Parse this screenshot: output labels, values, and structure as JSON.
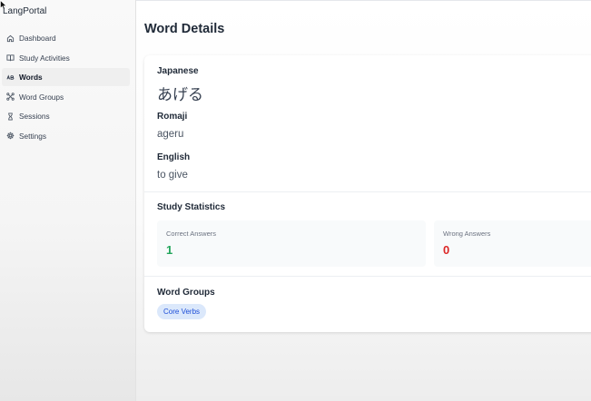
{
  "app": {
    "title": "LangPortal"
  },
  "sidebar": {
    "items": [
      {
        "label": "Dashboard",
        "icon": "home-icon",
        "active": false
      },
      {
        "label": "Study Activities",
        "icon": "book-icon",
        "active": false
      },
      {
        "label": "Words",
        "icon": "words-icon",
        "active": true
      },
      {
        "label": "Word Groups",
        "icon": "groups-icon",
        "active": false
      },
      {
        "label": "Sessions",
        "icon": "hourglass-icon",
        "active": false
      },
      {
        "label": "Settings",
        "icon": "gear-icon",
        "active": false
      }
    ]
  },
  "page": {
    "title": "Word Details"
  },
  "word": {
    "japanese_label": "Japanese",
    "japanese": "あげる",
    "romaji_label": "Romaji",
    "romaji": "ageru",
    "english_label": "English",
    "english": "to give"
  },
  "stats": {
    "title": "Study Statistics",
    "correct_label": "Correct Answers",
    "correct": "1",
    "wrong_label": "Wrong Answers",
    "wrong": "0"
  },
  "groups": {
    "title": "Word Groups",
    "items": [
      "Core Verbs"
    ]
  },
  "colors": {
    "correct": "#22a55b",
    "wrong": "#dc2626",
    "badge_bg": "#dbe8fb",
    "badge_text": "#1d4ed8",
    "active_nav_bg": "#efefef"
  }
}
